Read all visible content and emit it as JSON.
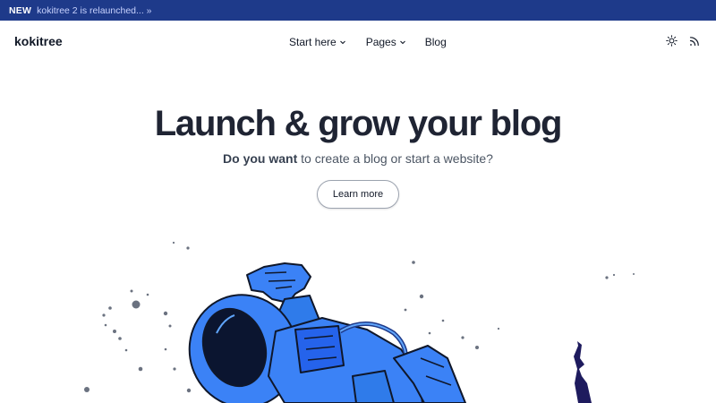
{
  "announcement": {
    "badge": "NEW",
    "message": "kokitree 2 is relaunched... »"
  },
  "nav": {
    "logo": "kokitree",
    "menu": [
      {
        "label": "Start here",
        "has_dropdown": true
      },
      {
        "label": "Pages",
        "has_dropdown": true
      },
      {
        "label": "Blog",
        "has_dropdown": false
      }
    ],
    "icons": [
      "sun-icon",
      "rss-icon"
    ]
  },
  "hero": {
    "title": "Launch & grow your blog",
    "subtitle_bold": "Do you want",
    "subtitle_rest": "to create a blog or start a website?",
    "cta_label": "Learn more"
  },
  "colors": {
    "announcement_bg": "#1e3a8a",
    "astronaut_blue": "#3b82f6",
    "text_dark": "#1f2433"
  }
}
